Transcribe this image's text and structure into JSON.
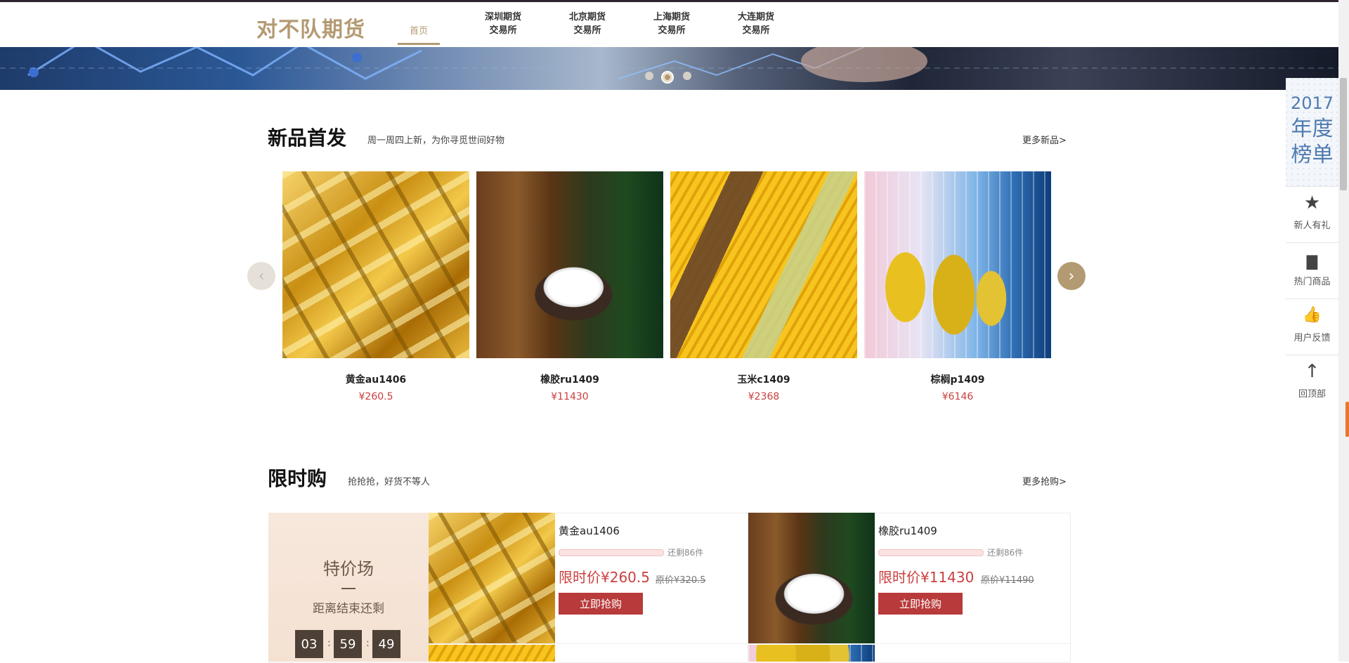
{
  "header": {
    "logo": "对不队期货",
    "nav": [
      {
        "label": "首页"
      },
      {
        "line1": "深圳期货",
        "line2": "交易所"
      },
      {
        "line1": "北京期货",
        "line2": "交易所"
      },
      {
        "line1": "上海期货",
        "line2": "交易所"
      },
      {
        "line1": "大连期货",
        "line2": "交易所"
      }
    ]
  },
  "banner": {
    "slides": 3,
    "active_slide": 2
  },
  "new_products": {
    "title": "新品首发",
    "subtitle": "周一周四上新，为你寻觅世间好物",
    "more": "更多新品>",
    "prev_icon": "‹",
    "next_icon": "›",
    "items": [
      {
        "name": "黄金au1406",
        "price": "¥260.5",
        "image": "gold-bars"
      },
      {
        "name": "橡胶ru1409",
        "price": "¥11430",
        "image": "rubber-tapping"
      },
      {
        "name": "玉米c1409",
        "price": "¥2368",
        "image": "corn"
      },
      {
        "name": "棕榈p1409",
        "price": "¥6146",
        "image": "palm-oil"
      }
    ]
  },
  "flash_sale": {
    "title": "限时购",
    "subtitle": "抢抢抢，好货不等人",
    "more": "更多抢购>",
    "promo": {
      "title": "特价场",
      "dash": "—",
      "subtitle": "距离结束还剩",
      "hours": "03",
      "minutes": "59",
      "seconds": "49",
      "sep": ":"
    },
    "items": [
      {
        "name": "黄金au1406",
        "remaining": "还剩86件",
        "price": "限时价¥260.5",
        "original": "原价¥320.5",
        "button": "立即抢购",
        "image": "gold-bars"
      },
      {
        "name": "橡胶ru1409",
        "remaining": "还剩86件",
        "price": "限时价¥11430",
        "original": "原价¥11490",
        "button": "立即抢购",
        "image": "rubber-tapping"
      }
    ]
  },
  "sidebar": {
    "banner_year": "2017",
    "banner_line1": "年度",
    "banner_line2": "榜单",
    "items": [
      {
        "label": "新人有礼",
        "icon": "★",
        "icon_name": "star-icon"
      },
      {
        "label": "热门商品",
        "icon": "▇",
        "icon_name": "bar-chart-icon"
      },
      {
        "label": "用户反馈",
        "icon": "👍",
        "icon_name": "thumbs-up-icon"
      },
      {
        "label": "回顶部",
        "icon": "↑",
        "icon_name": "arrow-up-icon"
      }
    ]
  },
  "colors": {
    "brand": "#b39a72",
    "price": "#c9403f",
    "button": "#b83a3a"
  }
}
